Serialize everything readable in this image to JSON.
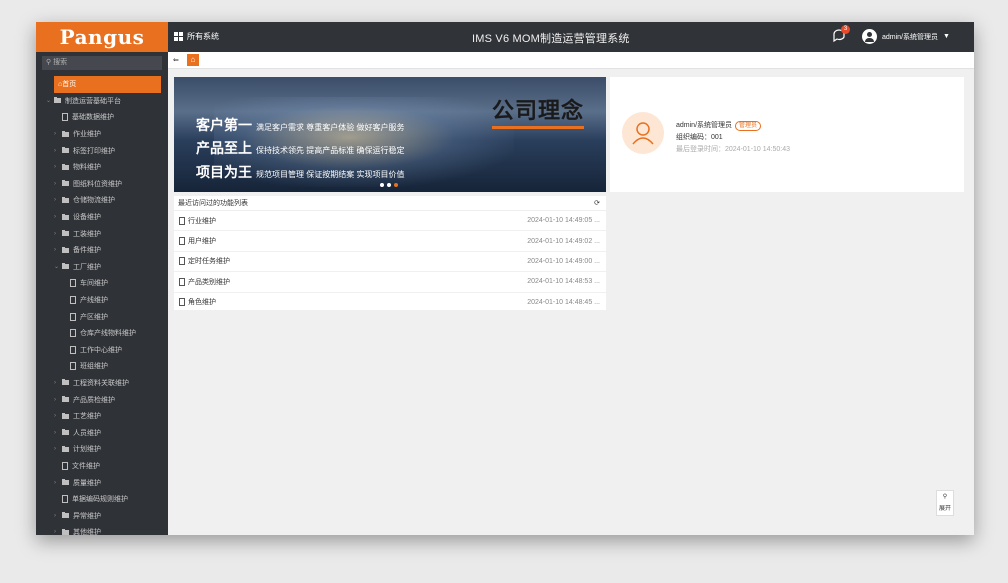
{
  "header": {
    "logo": "Pangus",
    "all_systems": "所有系统",
    "title": "IMS V6 MOM制造运营管理系统",
    "notification_count": "3",
    "user_name": "admin/系统管理员"
  },
  "sidebar": {
    "search_placeholder": "搜索",
    "items": [
      {
        "label": "首页",
        "type": "home",
        "active": true,
        "indent": 0
      },
      {
        "label": "制造运营基础平台",
        "type": "root",
        "indent": 0
      },
      {
        "label": "基础数据维护",
        "type": "doc",
        "indent": 1
      },
      {
        "label": "作业维护",
        "type": "folder",
        "indent": 1
      },
      {
        "label": "标签打印维护",
        "type": "folder",
        "indent": 1
      },
      {
        "label": "物料维护",
        "type": "folder",
        "indent": 1
      },
      {
        "label": "图纸料位资维护",
        "type": "folder",
        "indent": 1
      },
      {
        "label": "仓储物流维护",
        "type": "folder",
        "indent": 1
      },
      {
        "label": "设备维护",
        "type": "folder",
        "indent": 1
      },
      {
        "label": "工装维护",
        "type": "folder",
        "indent": 1
      },
      {
        "label": "备件维护",
        "type": "folder",
        "indent": 1
      },
      {
        "label": "工厂维护",
        "type": "folder-open",
        "indent": 1
      },
      {
        "label": "车间维护",
        "type": "doc",
        "indent": 2
      },
      {
        "label": "产线维护",
        "type": "doc",
        "indent": 2
      },
      {
        "label": "产区维护",
        "type": "doc",
        "indent": 2
      },
      {
        "label": "仓库产线物料维护",
        "type": "doc",
        "indent": 2
      },
      {
        "label": "工作中心维护",
        "type": "doc",
        "indent": 2
      },
      {
        "label": "班组维护",
        "type": "doc",
        "indent": 2
      },
      {
        "label": "工程资料关联维护",
        "type": "folder",
        "indent": 1
      },
      {
        "label": "产品质检维护",
        "type": "folder",
        "indent": 1
      },
      {
        "label": "工艺维护",
        "type": "folder",
        "indent": 1
      },
      {
        "label": "人员维护",
        "type": "folder",
        "indent": 1
      },
      {
        "label": "计划维护",
        "type": "folder",
        "indent": 1
      },
      {
        "label": "文件维护",
        "type": "doc",
        "indent": 1
      },
      {
        "label": "质量维护",
        "type": "folder",
        "indent": 1
      },
      {
        "label": "单据编码规则维护",
        "type": "doc",
        "indent": 1
      },
      {
        "label": "异常维护",
        "type": "folder",
        "indent": 1
      },
      {
        "label": "其他维护",
        "type": "folder",
        "indent": 1
      }
    ]
  },
  "banner": {
    "heading": "公司理念",
    "slogans": [
      {
        "main": "客户第一",
        "sub": "满足客户需求 尊重客户体验 做好客户服务"
      },
      {
        "main": "产品至上",
        "sub": "保持技术领先 提高产品标准 确保运行稳定"
      },
      {
        "main": "项目为王",
        "sub": "规范项目管理 保证按期结案 实现项目价值"
      }
    ]
  },
  "profile": {
    "name": "admin/系统管理员",
    "role": "管理员",
    "org_code": "组织编码：001",
    "last_login": "最后登录时间：2024-01-10 14:50:43"
  },
  "recent_functions": {
    "title": "最近访问过的功能列表",
    "rows": [
      {
        "name": "行业维护",
        "time": "2024-01-10 14:49:05 ..."
      },
      {
        "name": "用户维护",
        "time": "2024-01-10 14:49:02 ..."
      },
      {
        "name": "定时任务维护",
        "time": "2024-01-10 14:49:00 ..."
      },
      {
        "name": "产品类别维护",
        "time": "2024-01-10 14:48:53 ..."
      },
      {
        "name": "角色维护",
        "time": "2024-01-10 14:48:45 ..."
      }
    ]
  },
  "float_button": {
    "label": "展开"
  },
  "colors": {
    "accent": "#e8701e",
    "topbar": "#303338",
    "sidebar": "#2f3237"
  }
}
